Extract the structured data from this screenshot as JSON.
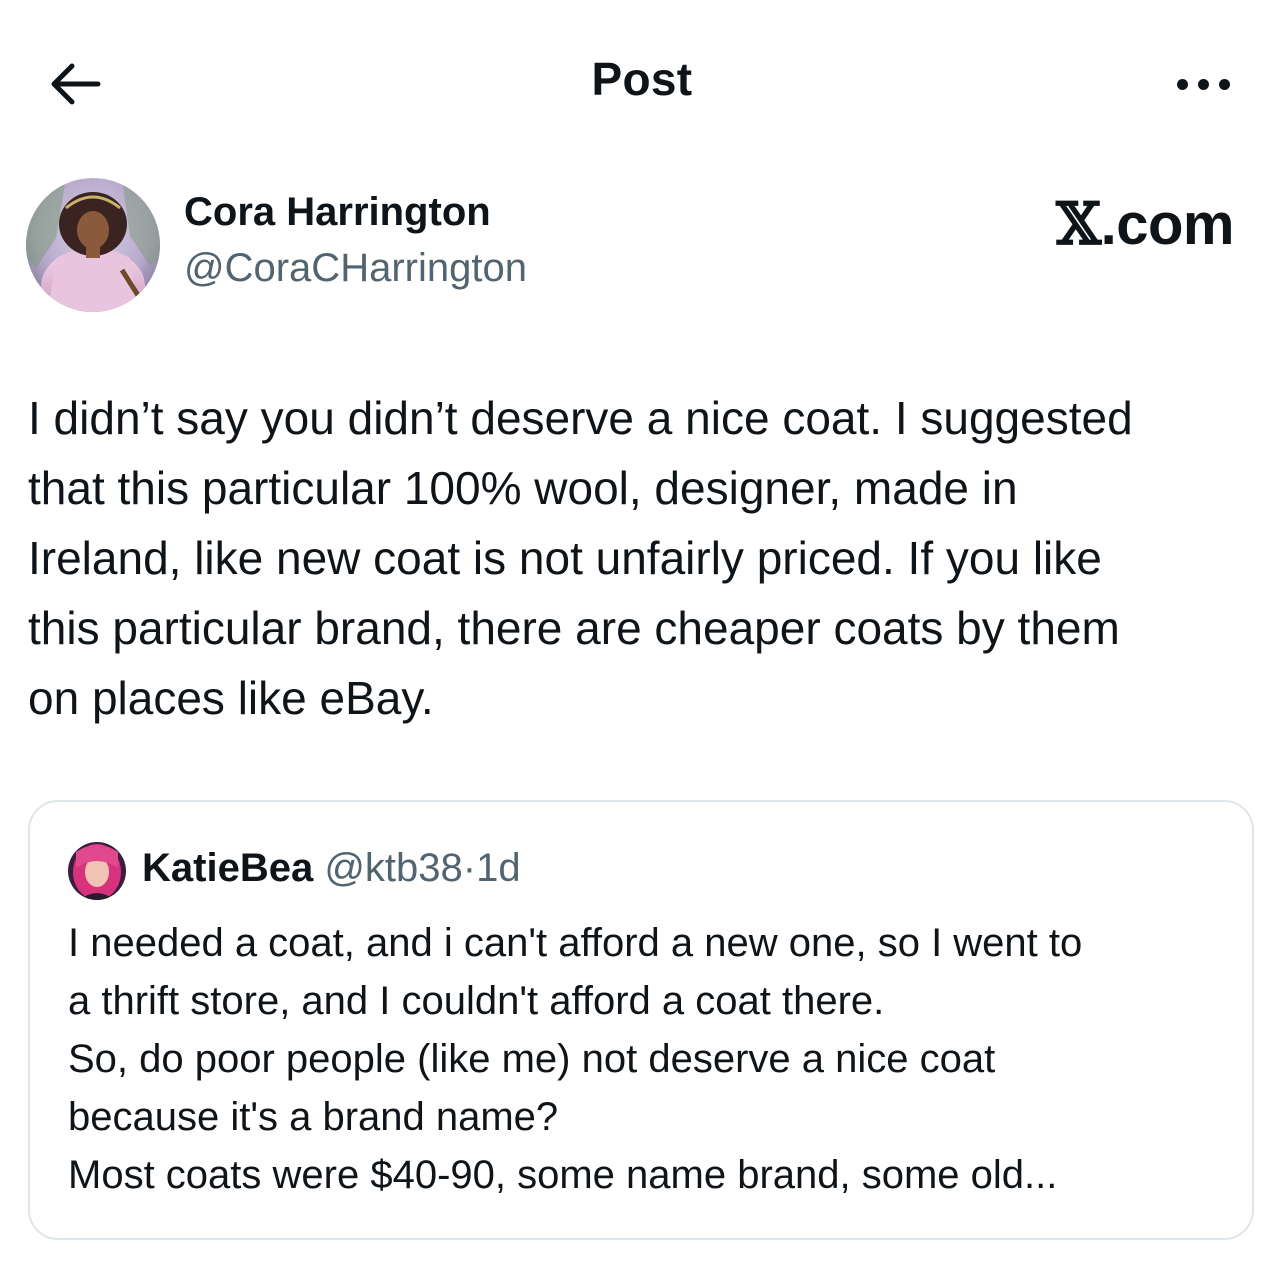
{
  "header": {
    "title": "Post",
    "back_icon": "arrow-left-icon",
    "more_icon": "more-horizontal-icon"
  },
  "author": {
    "name": "Cora Harrington",
    "handle": "@CoraCHarrington"
  },
  "brand": {
    "x_glyph": "𝕏",
    "suffix": ".com"
  },
  "post": {
    "text": "I didn’t say you didn’t deserve a nice coat. I suggested\nthat this particular 100% wool, designer, made in\nIreland, like new coat is not unfairly priced. If you like\nthis particular brand, there are cheaper coats by them\non places like eBay."
  },
  "quoted_post": {
    "name": "KatieBea",
    "handle": "@ktb38",
    "separator": "·",
    "time": "1d",
    "text": "I needed a coat, and i can't afford a new one, so I went to\na thrift store, and I couldn't afford a coat there.\nSo, do poor people (like me) not deserve a nice coat\nbecause it's a brand name?\nMost coats were $40-90, some name brand, some old..."
  },
  "colors": {
    "text_primary": "#0f1419",
    "text_secondary": "#536471",
    "border": "#dfe6ea"
  }
}
